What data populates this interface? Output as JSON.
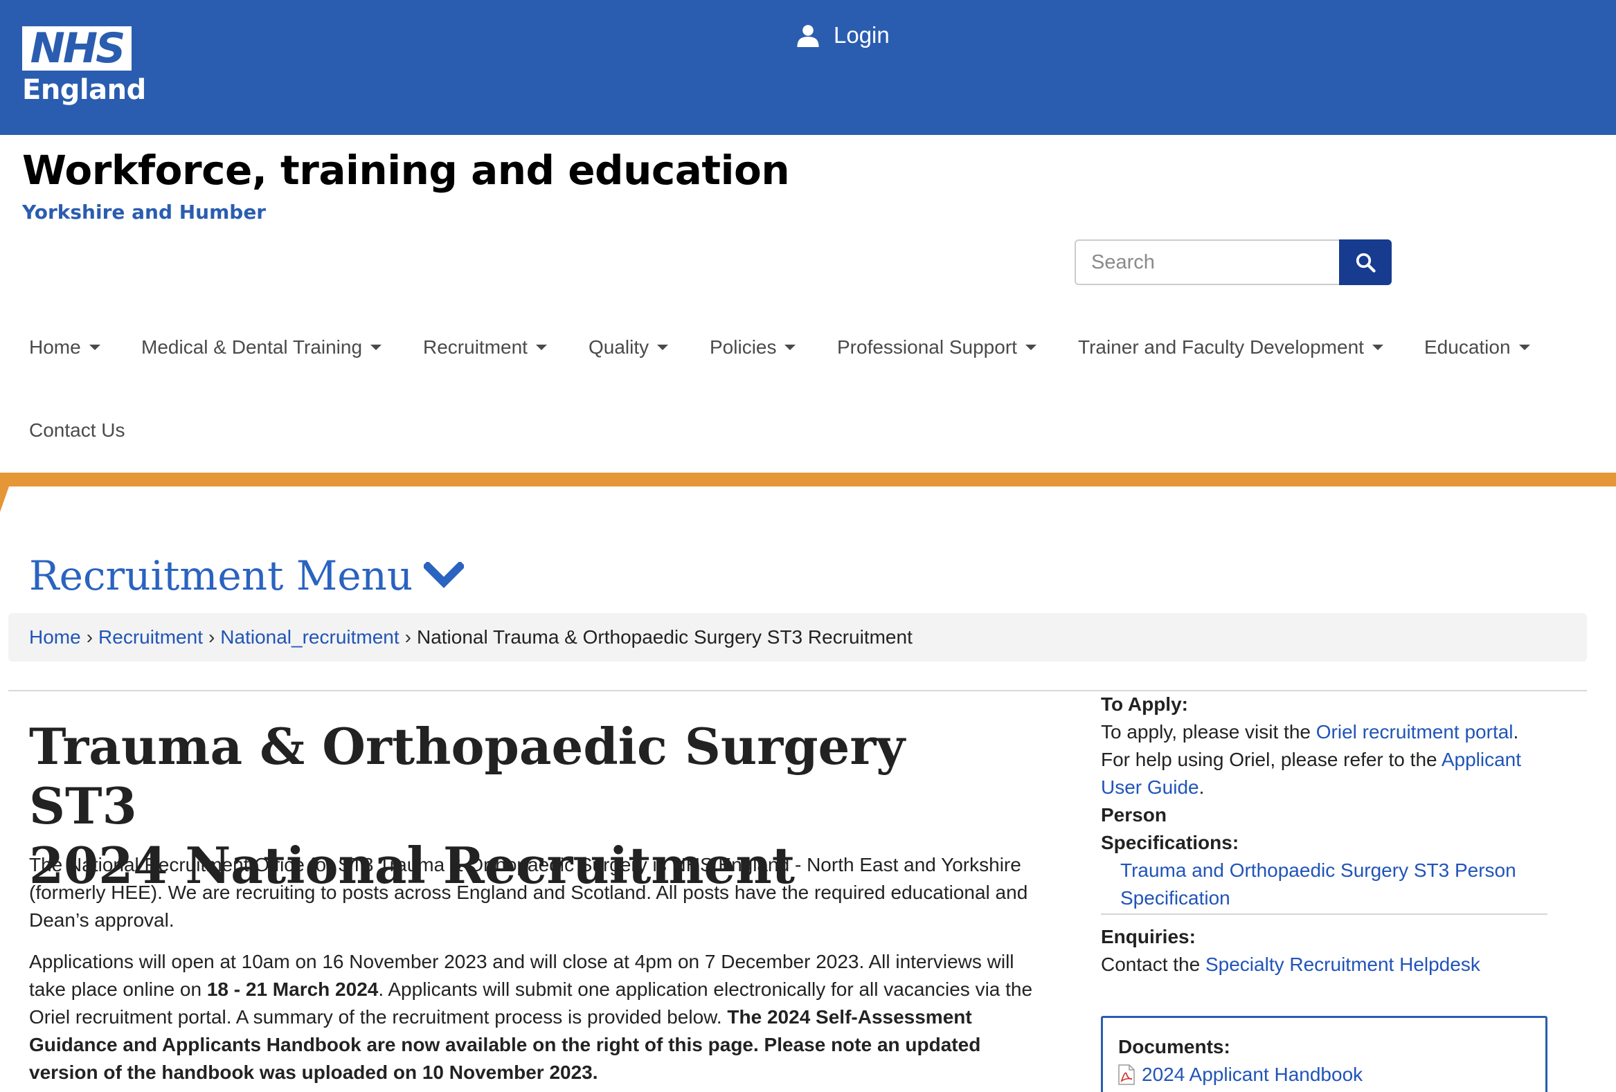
{
  "header": {
    "logo_top": "NHS",
    "logo_bottom": "England",
    "login_label": "Login",
    "site_title": "Workforce, training and education",
    "site_subtitle": "Yorkshire and Humber",
    "brand_color": "#2a5db0"
  },
  "search": {
    "placeholder": "Search"
  },
  "nav": {
    "items": [
      {
        "label": "Home"
      },
      {
        "label": "Medical & Dental Training"
      },
      {
        "label": "Recruitment"
      },
      {
        "label": "Quality"
      },
      {
        "label": "Policies"
      },
      {
        "label": "Professional Support"
      },
      {
        "label": "Trainer and Faculty Development"
      },
      {
        "label": "Education"
      },
      {
        "label": "Contact Us"
      }
    ],
    "accent_color": "#e59636"
  },
  "recruitment_menu": {
    "label": "Recruitment Menu"
  },
  "breadcrumb": {
    "items": [
      "Home",
      "Recruitment",
      "National_recruitment"
    ],
    "current": "National Trauma & Orthopaedic Surgery ST3 Recruitment",
    "separator": "›"
  },
  "main": {
    "title_line1": "Trauma & Orthopaedic Surgery ST3",
    "title_line2": "2024 National Recruitment",
    "p1": "The National Recruitment Office for ST3 Trauma & Orthopaedic Surgery is NHS England - North East and Yorkshire (formerly HEE). We are recruiting to posts across England and Scotland. All posts have the required educational and Dean’s approval.",
    "p2_a": "Applications will open at 10am on 16 November 2023 and will close at 4pm on 7 December 2023.  All interviews will take place online on ",
    "p2_b": "18 - 21 March 2024",
    "p2_c": ".  Applicants will submit one application electronically for all vacancies via the Oriel recruitment portal. A summary of the recruitment process is provided below. ",
    "p2_d": "The 2024 Self-Assessment Guidance and Applicants Handbook are now available on the right of this page. Please note an updated version of the handbook was uploaded on 10 November 2023."
  },
  "sidebar": {
    "apply_label": "To Apply:",
    "apply_text1": "To apply, please visit the ",
    "apply_link1": "Oriel recruitment portal",
    "apply_text2": ".",
    "apply_text3": "For help using Oriel, please refer to the ",
    "apply_link2": "Applicant User Guide",
    "apply_text4": ".",
    "person_label_1": "Person",
    "person_label_2": "Specifications:",
    "person_link": "Trauma and Orthopaedic Surgery ST3 Person Specification",
    "enquiries_label": "Enquiries:",
    "enquiries_text": "Contact the ",
    "enquiries_link": "Specialty Recruitment Helpdesk",
    "documents_label": "Documents:",
    "document_1": "2024 Applicant Handbook"
  }
}
